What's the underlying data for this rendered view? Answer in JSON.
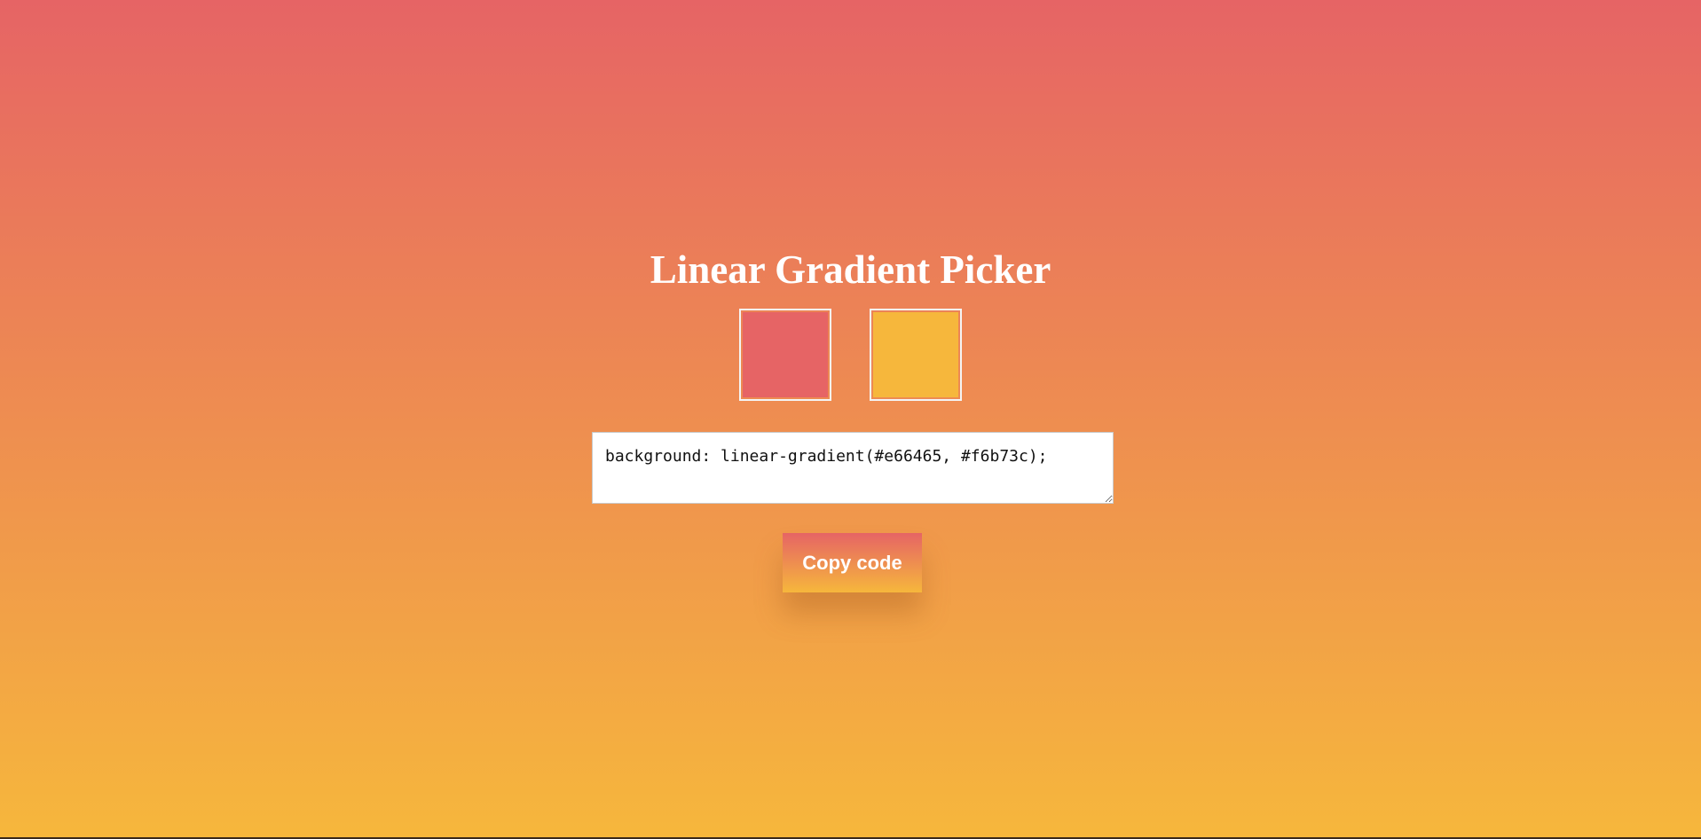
{
  "header": {
    "title": "Linear Gradient Picker"
  },
  "colors": {
    "color1": "#e66465",
    "color2": "#f6b73c"
  },
  "output": {
    "code": "background: linear-gradient(#e66465, #f6b73c);"
  },
  "actions": {
    "copy_label": "Copy code"
  }
}
